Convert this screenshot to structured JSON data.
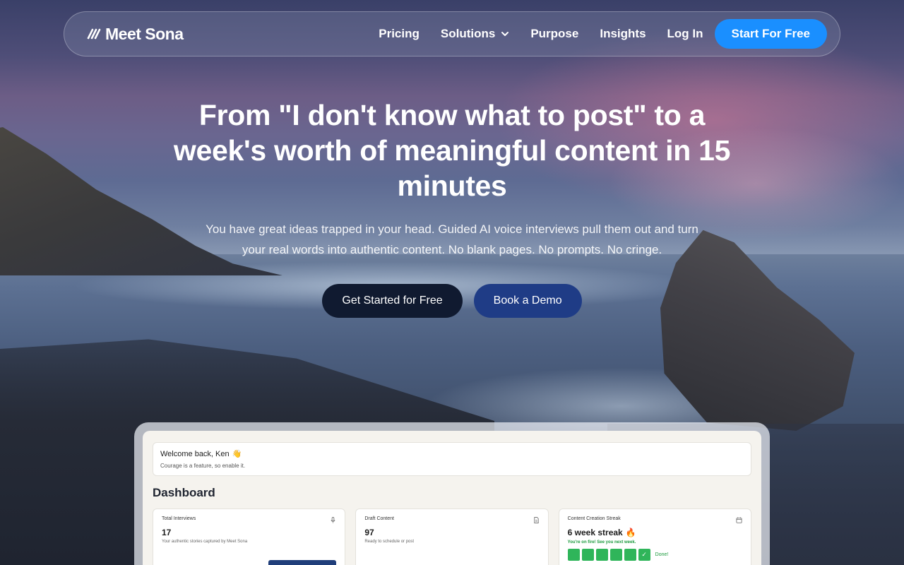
{
  "brand": {
    "name": "Meet Sona",
    "logo_icon": "stripes-logo-icon"
  },
  "nav": {
    "links": [
      {
        "label": "Pricing"
      },
      {
        "label": "Solutions",
        "has_dropdown": true
      },
      {
        "label": "Purpose"
      },
      {
        "label": "Insights"
      },
      {
        "label": "Log In"
      }
    ],
    "cta": "Start For Free",
    "accent": "#1a8fff"
  },
  "hero": {
    "title": "From \"I don't know what to post\" to a week's worth of meaningful content in 15 minutes",
    "subtitle": "You have great ideas trapped in your head. Guided AI voice interviews pull them out and turn your real words into authentic content. No blank pages. No prompts. No cringe.",
    "primary_button": "Get Started for Free",
    "secondary_button": "Book a Demo"
  },
  "dashboard": {
    "welcome_title": "Welcome back, Ken",
    "welcome_emoji": "👋",
    "welcome_sub": "Courage is a feature, so enable it.",
    "title": "Dashboard",
    "cards": [
      {
        "label": "Total Interviews",
        "icon": "microphone-icon",
        "value": "17",
        "desc": "Your authentic stories captured by Meet Sona"
      },
      {
        "label": "Draft Content",
        "icon": "document-icon",
        "value": "97",
        "desc": "Ready to schedule or post"
      }
    ],
    "streak": {
      "label": "Content Creation Streak",
      "icon": "calendar-icon",
      "title": "6 week streak",
      "emoji": "🔥",
      "sub": "You're on fire! See you next week.",
      "done_label": "Done!",
      "check": "✓"
    }
  }
}
